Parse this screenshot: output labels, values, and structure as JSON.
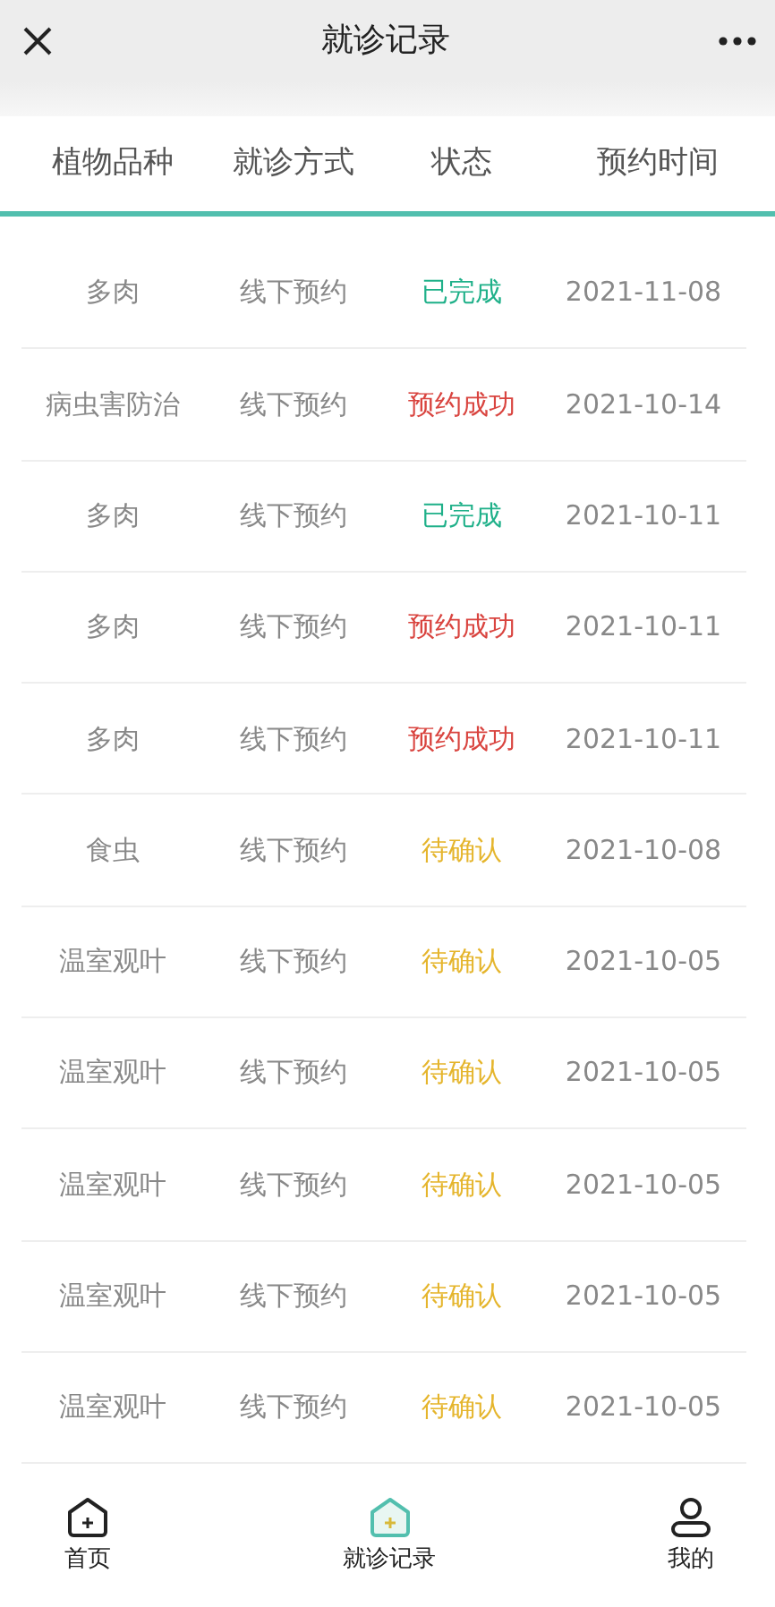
{
  "nav_bar": {
    "title": "就诊记录"
  },
  "table": {
    "columns": [
      "植物品种",
      "就诊方式",
      "状态",
      "预约时间"
    ],
    "rows": [
      {
        "plant": "多肉",
        "method": "线下预约",
        "status": "已完成",
        "color": "#1fb089",
        "time": "2021-11-08"
      },
      {
        "plant": "病虫害防治",
        "method": "线下预约",
        "status": "预约成功",
        "color": "#d9443f",
        "time": "2021-10-14"
      },
      {
        "plant": "多肉",
        "method": "线下预约",
        "status": "已完成",
        "color": "#1fb089",
        "time": "2021-10-11"
      },
      {
        "plant": "多肉",
        "method": "线下预约",
        "status": "预约成功",
        "color": "#d9443f",
        "time": "2021-10-11"
      },
      {
        "plant": "多肉",
        "method": "线下预约",
        "status": "预约成功",
        "color": "#d9443f",
        "time": "2021-10-11"
      },
      {
        "plant": "食虫",
        "method": "线下预约",
        "status": "待确认",
        "color": "#e5b52c",
        "time": "2021-10-08"
      },
      {
        "plant": "温室观叶",
        "method": "线下预约",
        "status": "待确认",
        "color": "#e5b52c",
        "time": "2021-10-05"
      },
      {
        "plant": "温室观叶",
        "method": "线下预约",
        "status": "待确认",
        "color": "#e5b52c",
        "time": "2021-10-05"
      },
      {
        "plant": "温室观叶",
        "method": "线下预约",
        "status": "待确认",
        "color": "#e5b52c",
        "time": "2021-10-05"
      },
      {
        "plant": "温室观叶",
        "method": "线下预约",
        "status": "待确认",
        "color": "#e5b52c",
        "time": "2021-10-05"
      },
      {
        "plant": "温室观叶",
        "method": "线下预约",
        "status": "待确认",
        "color": "#e5b52c",
        "time": "2021-10-05"
      }
    ]
  },
  "tab_bar": [
    {
      "label": "首页",
      "kind": "house",
      "selected": false
    },
    {
      "label": "就诊记录",
      "kind": "house",
      "selected": true
    },
    {
      "label": "我的",
      "kind": "person",
      "selected": false
    }
  ]
}
